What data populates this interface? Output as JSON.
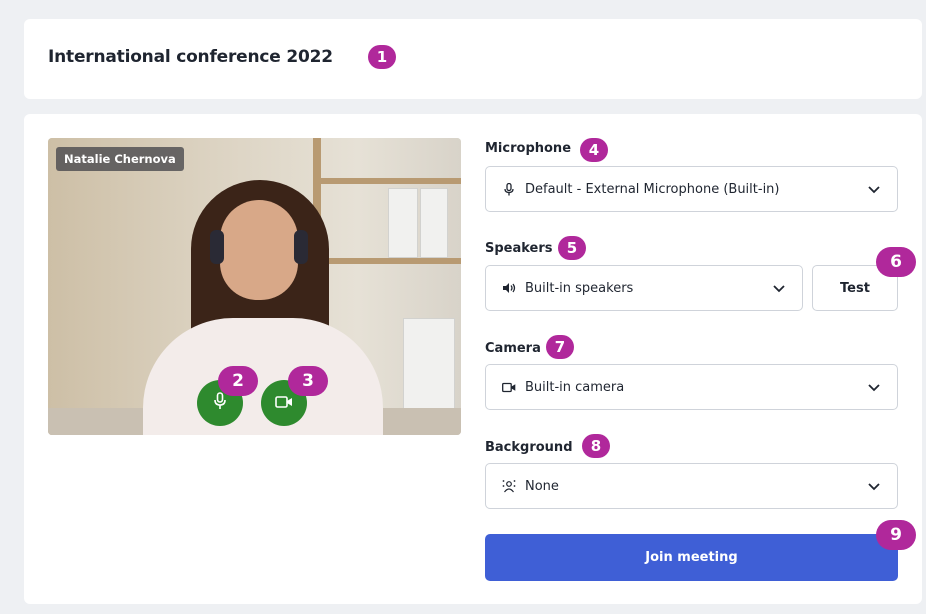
{
  "header": {
    "title": "International conference 2022",
    "badge": "1"
  },
  "video": {
    "participant_name": "Natalie Chernova",
    "mic_button": {
      "icon": "microphone-icon",
      "badge": "2"
    },
    "camera_button": {
      "icon": "video-camera-icon",
      "badge": "3"
    }
  },
  "microphone": {
    "label": "Microphone",
    "badge": "4",
    "icon": "microphone-icon",
    "value": "Default - External Microphone (Built-in)"
  },
  "speakers": {
    "label": "Speakers",
    "badge": "5",
    "icon": "speaker-icon",
    "value": "Built-in speakers",
    "test_label": "Test",
    "test_badge": "6"
  },
  "camera": {
    "label": "Camera",
    "badge": "7",
    "icon": "camera-icon",
    "value": "Built-in camera"
  },
  "background": {
    "label": "Background",
    "badge": "8",
    "icon": "background-blur-icon",
    "value": "None"
  },
  "join": {
    "label": "Join meeting",
    "badge": "9"
  },
  "colors": {
    "accent": "#3f5fd6",
    "badge": "#b0289b",
    "green": "#2e8a2e"
  }
}
